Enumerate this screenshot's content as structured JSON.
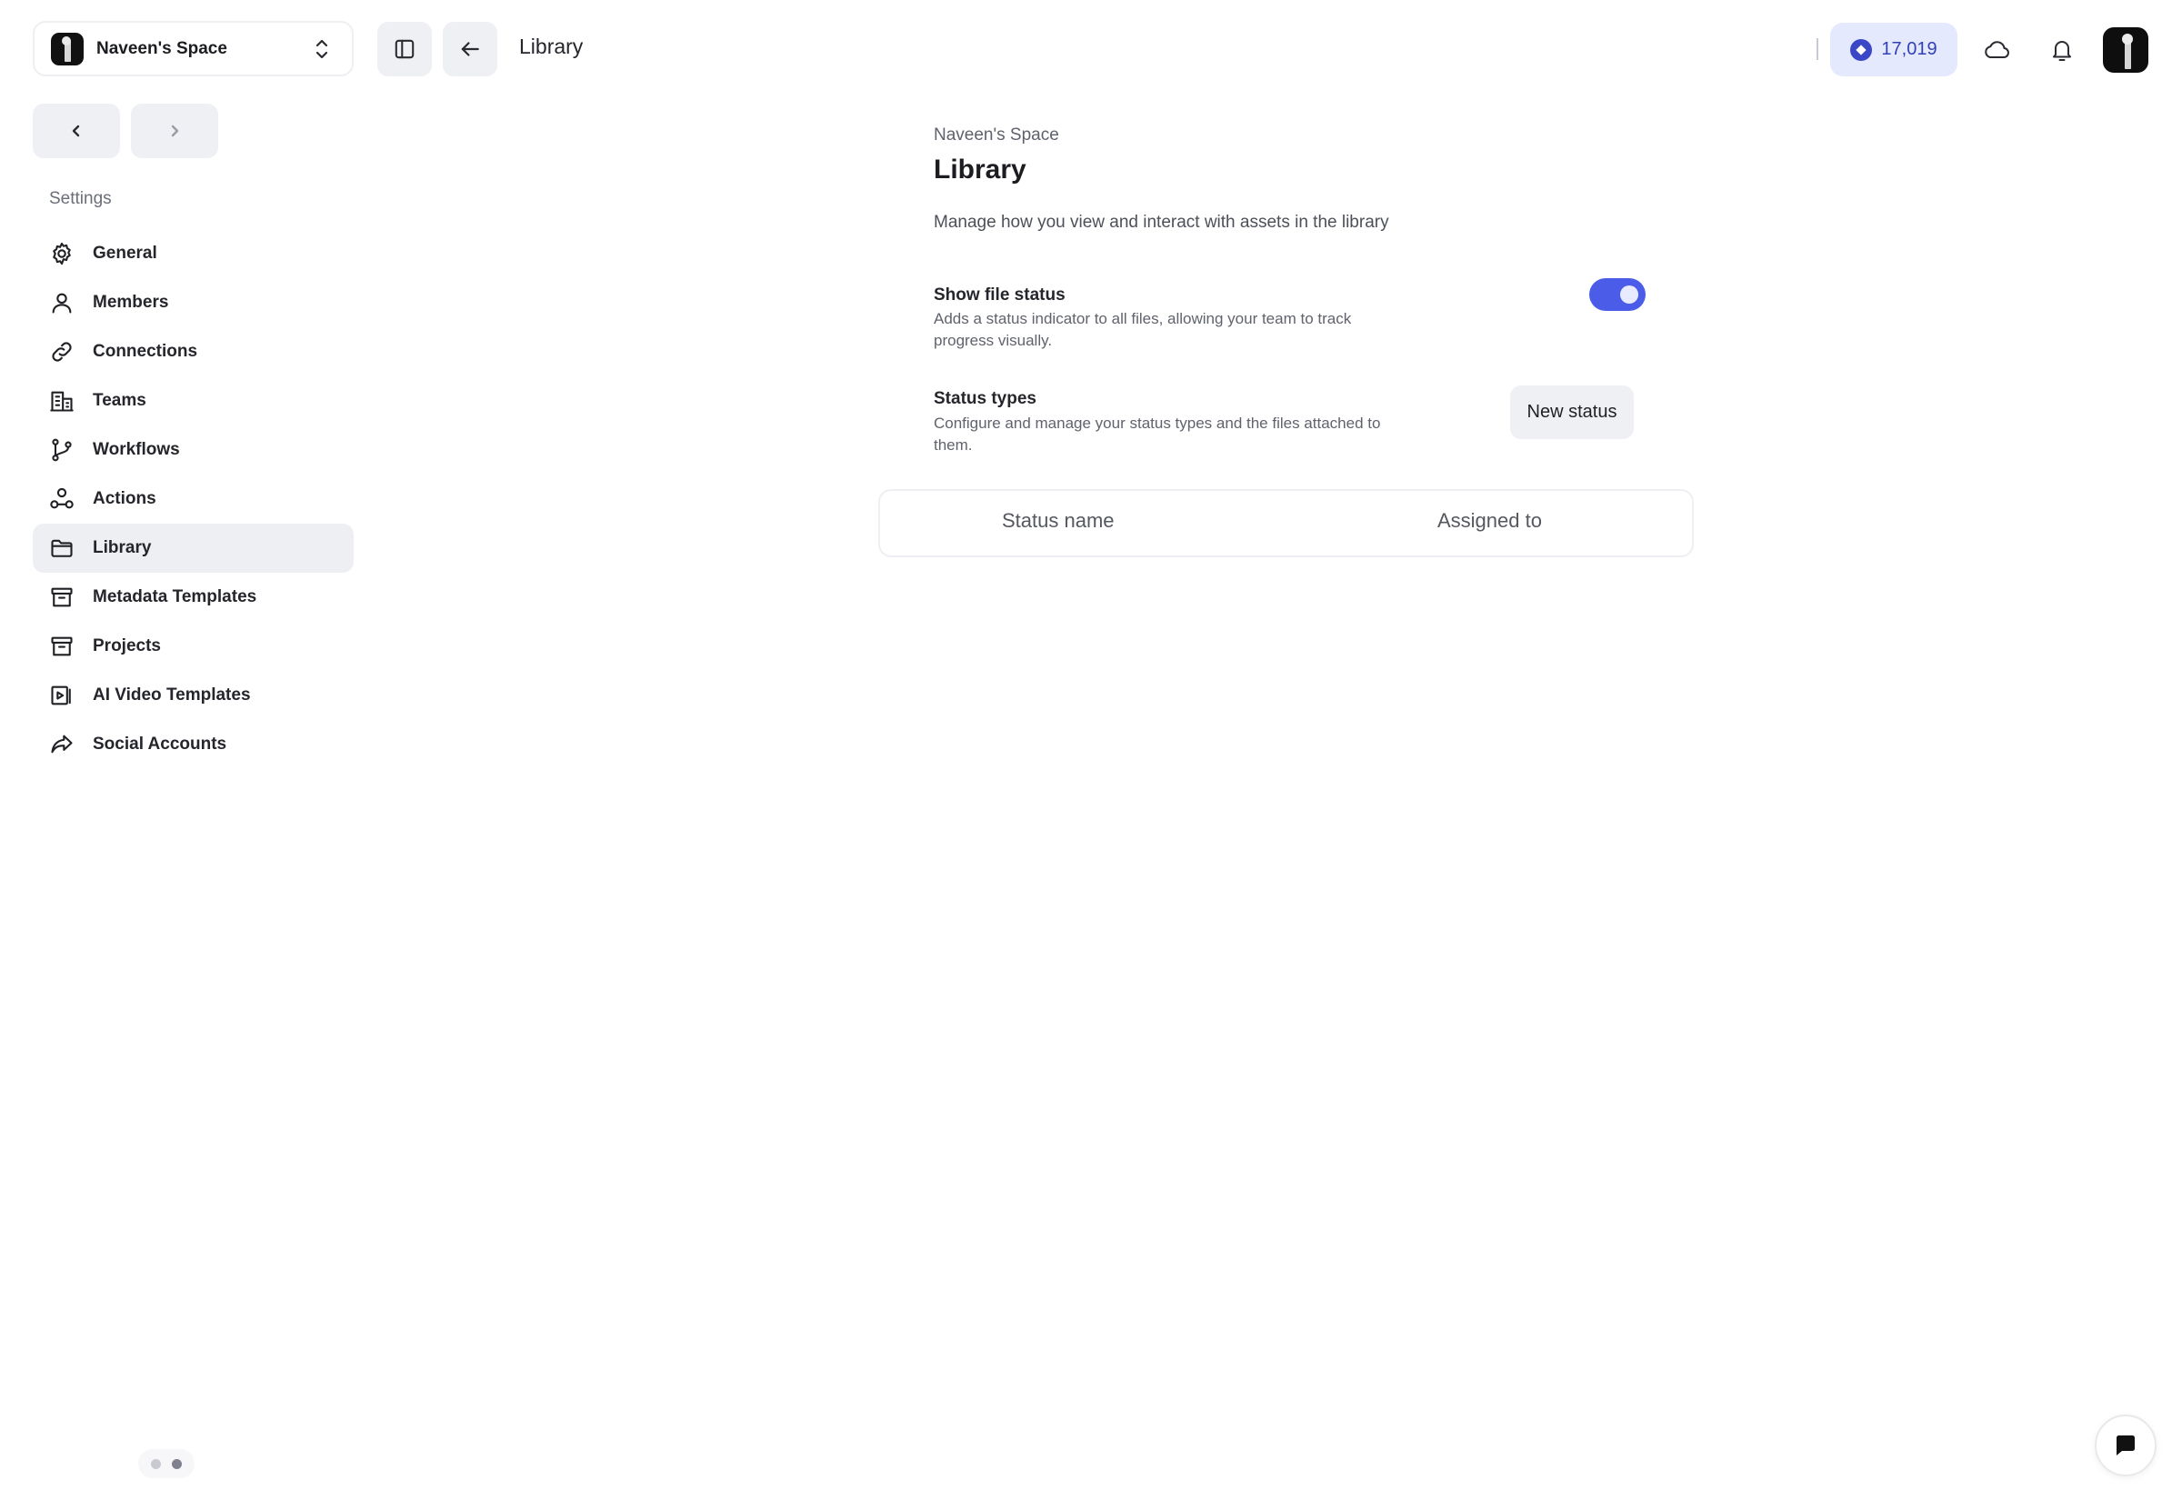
{
  "workspace": {
    "name": "Naveen's Space"
  },
  "sidebar": {
    "heading": "Settings",
    "items": [
      {
        "label": "General",
        "icon": "gear-icon"
      },
      {
        "label": "Members",
        "icon": "user-icon"
      },
      {
        "label": "Connections",
        "icon": "link-icon"
      },
      {
        "label": "Teams",
        "icon": "building-icon"
      },
      {
        "label": "Workflows",
        "icon": "git-branch-icon"
      },
      {
        "label": "Actions",
        "icon": "nodes-icon"
      },
      {
        "label": "Library",
        "icon": "folder-icon",
        "active": true
      },
      {
        "label": "Metadata Templates",
        "icon": "archive-icon"
      },
      {
        "label": "Projects",
        "icon": "archive-icon"
      },
      {
        "label": "AI Video Templates",
        "icon": "video-template-icon"
      },
      {
        "label": "Social Accounts",
        "icon": "share-icon"
      }
    ]
  },
  "topbar": {
    "title": "Library",
    "credits": "17,019"
  },
  "main": {
    "eyebrow": "Naveen's Space",
    "title": "Library",
    "description": "Manage how you view and interact with assets in the library",
    "show_file_status": {
      "title": "Show file status",
      "description": "Adds a status indicator to all files, allowing your team to track progress visually.",
      "enabled": true
    },
    "status_types": {
      "title": "Status types",
      "description": "Configure and manage your status types and the files attached to them.",
      "button_label": "New status"
    },
    "table": {
      "columns": [
        "Status name",
        "Assigned to"
      ]
    }
  },
  "colors": {
    "accent": "#4a5ce8",
    "credits_bg": "#e5e9fd",
    "credits_text": "#3140b8",
    "active_nav_bg": "#eeeff3"
  }
}
